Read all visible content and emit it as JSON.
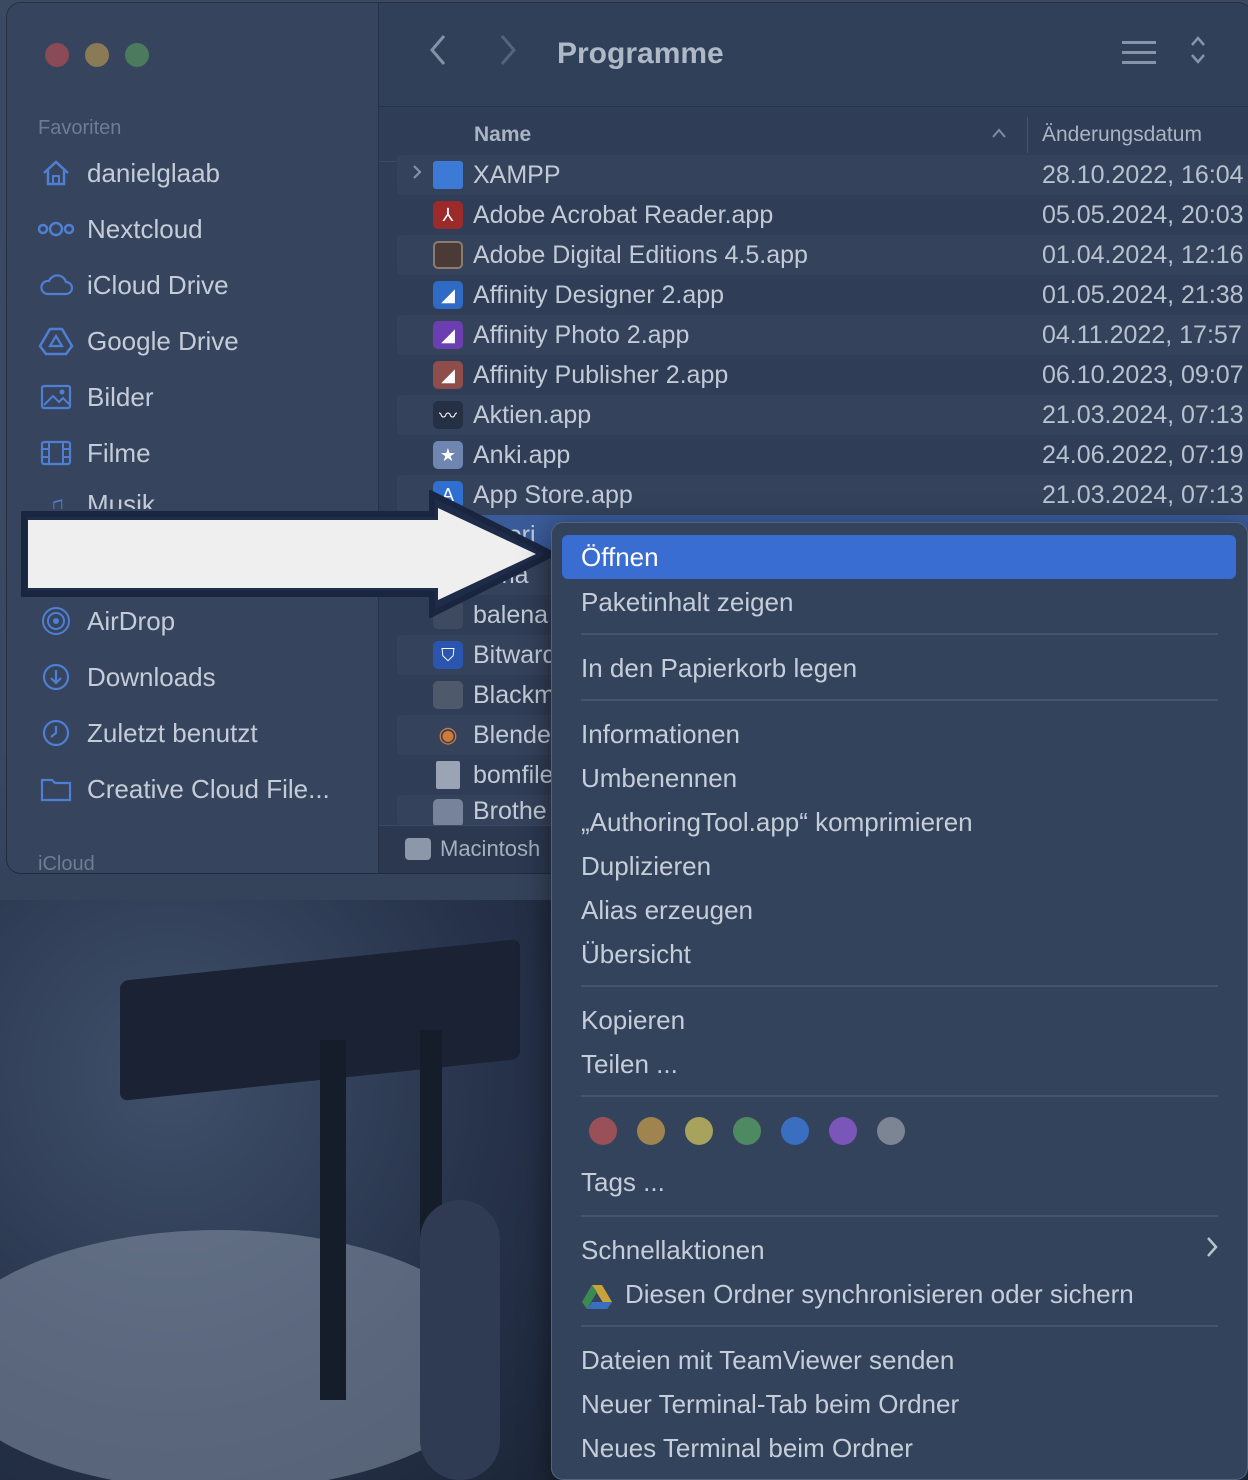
{
  "window": {
    "title": "Programme"
  },
  "sidebar": {
    "favorites_header": "Favoriten",
    "icloud_header": "iCloud",
    "items": [
      {
        "label": "danielglaab",
        "icon": "home-icon"
      },
      {
        "label": "Nextcloud",
        "icon": "nextcloud-icon"
      },
      {
        "label": "iCloud Drive",
        "icon": "cloud-icon"
      },
      {
        "label": "Google Drive",
        "icon": "google-drive-icon"
      },
      {
        "label": "Bilder",
        "icon": "photo-icon"
      },
      {
        "label": "Filme",
        "icon": "film-icon"
      },
      {
        "label": "Musik",
        "icon": "music-icon"
      },
      {
        "label": "AirDrop",
        "icon": "airdrop-icon"
      },
      {
        "label": "Downloads",
        "icon": "download-icon"
      },
      {
        "label": "Zuletzt benutzt",
        "icon": "clock-icon"
      },
      {
        "label": "Creative Cloud File...",
        "icon": "folder-icon"
      }
    ]
  },
  "list": {
    "col_name": "Name",
    "col_date": "Änderungsdatum",
    "rows": [
      {
        "name": "XAMPP",
        "date": "28.10.2022, 16:04",
        "icon": "folder-icon"
      },
      {
        "name": "Adobe Acrobat Reader.app",
        "date": "05.05.2024, 20:03",
        "icon": "acrobat-icon"
      },
      {
        "name": "Adobe Digital Editions 4.5.app",
        "date": "01.04.2024, 12:16",
        "icon": "digital-editions-icon"
      },
      {
        "name": "Affinity Designer 2.app",
        "date": "01.05.2024, 21:38",
        "icon": "affinity-designer-icon"
      },
      {
        "name": "Affinity Photo 2.app",
        "date": "04.11.2022, 17:57",
        "icon": "affinity-photo-icon"
      },
      {
        "name": "Affinity Publisher 2.app",
        "date": "06.10.2023, 09:07",
        "icon": "affinity-publisher-icon"
      },
      {
        "name": "Aktien.app",
        "date": "21.03.2024, 07:13",
        "icon": "stocks-icon"
      },
      {
        "name": "Anki.app",
        "date": "24.06.2022, 07:19",
        "icon": "anki-icon"
      },
      {
        "name": "App Store.app",
        "date": "21.03.2024, 07:13",
        "icon": "app-store-icon"
      },
      {
        "name": "AuthoringTool.app",
        "date": "",
        "icon": "app-icon"
      },
      {
        "name": "Automator.app",
        "date": "",
        "icon": "automator-icon"
      },
      {
        "name": "balenaEtcher.app",
        "date": "",
        "icon": "balena-icon"
      },
      {
        "name": "Bitwarden.app",
        "date": "",
        "icon": "bitwarden-icon"
      },
      {
        "name": "Blackmagic.app",
        "date": "",
        "icon": "blackmagic-icon"
      },
      {
        "name": "Blender.app",
        "date": "",
        "icon": "blender-icon"
      },
      {
        "name": "bomfile",
        "date": "",
        "icon": "document-icon"
      },
      {
        "name": "Brother",
        "date": "",
        "icon": "brother-icon"
      }
    ],
    "visible_names": [
      "XAMPP",
      "Adobe Acrobat Reader.app",
      "Adobe Digital Editions 4.5.app",
      "Affinity Designer 2.app",
      "Affinity Photo 2.app",
      "Affinity Publisher 2.app",
      "Aktien.app",
      "Anki.app",
      "App Store.app",
      "uthori",
      "toma",
      "balena",
      "Bitward",
      "Blackm",
      "Blende",
      "bomfile",
      "Brothe"
    ]
  },
  "pathbar": {
    "label": "Macintosh"
  },
  "context_menu": {
    "highlighted": "Öffnen",
    "show_package": "Paketinhalt zeigen",
    "trash": "In den Papierkorb legen",
    "info": "Informationen",
    "rename": "Umbenennen",
    "compress": "„AuthoringTool.app“ komprimieren",
    "duplicate": "Duplizieren",
    "alias": "Alias erzeugen",
    "quicklook": "Übersicht",
    "copy": "Kopieren",
    "share": "Teilen ...",
    "tag_colors": [
      "#9a5059",
      "#a08450",
      "#a8a35c",
      "#4e8a61",
      "#3a6ec0",
      "#7a56b8",
      "#7c8594"
    ],
    "tags": "Tags ...",
    "quick_actions": "Schnellaktionen",
    "gdrive_sync": "Diesen Ordner synchronisieren oder sichern",
    "teamviewer": "Dateien mit TeamViewer senden",
    "terminal_tab": "Neuer Terminal-Tab beim Ordner",
    "terminal": "Neues Terminal beim Ordner"
  }
}
